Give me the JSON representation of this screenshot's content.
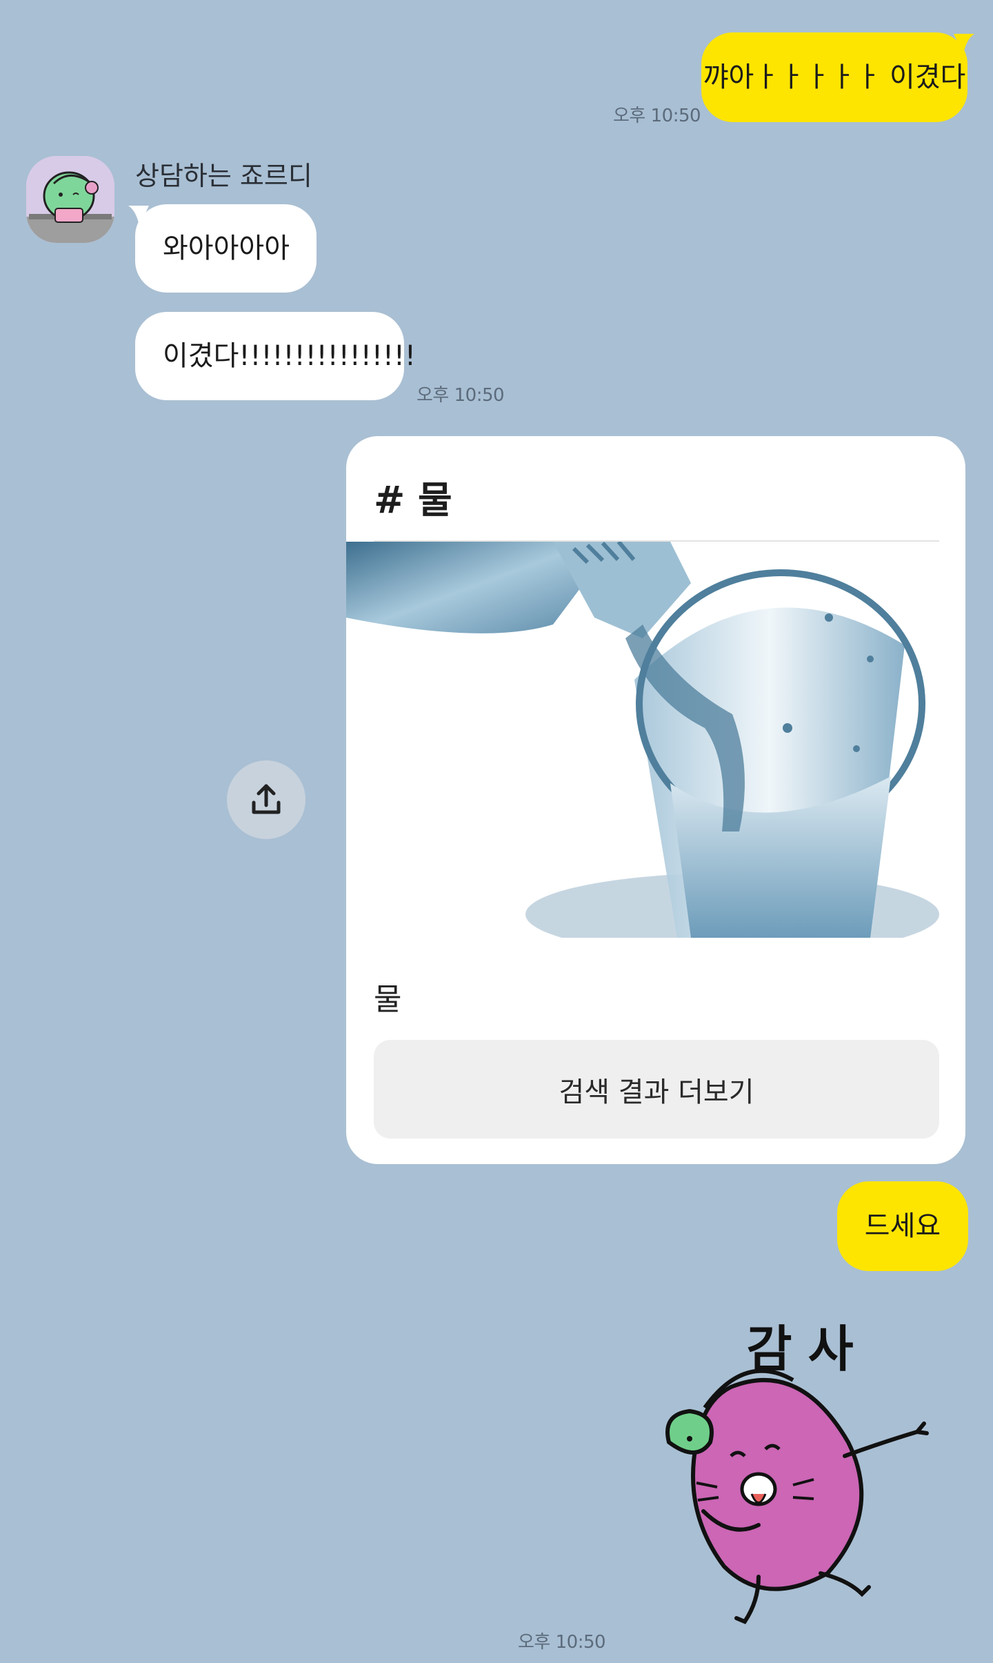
{
  "messages": {
    "m1": {
      "text": "꺄아ㅏㅏㅏㅏㅏ 이겼다",
      "time": "오후 10:50"
    },
    "sender_name": "상담하는 죠르디",
    "m2": {
      "text": "와아아아아"
    },
    "m3": {
      "text": "이겼다!!!!!!!!!!!!!!!!",
      "time": "오후 10:50"
    },
    "card": {
      "title": "# 물",
      "image_label": "water-pouring-image",
      "description": "물",
      "button_label": "검색 결과 더보기"
    },
    "m4": {
      "text": "드세요"
    },
    "sticker": {
      "caption": "감 사",
      "time": "오후 10:50"
    }
  },
  "colors": {
    "background": "#a9bfd3",
    "my_bubble": "#fee500",
    "other_bubble": "#ffffff",
    "sticker_body": "#cc66b5",
    "sticker_leaf": "#6fcf8a"
  }
}
